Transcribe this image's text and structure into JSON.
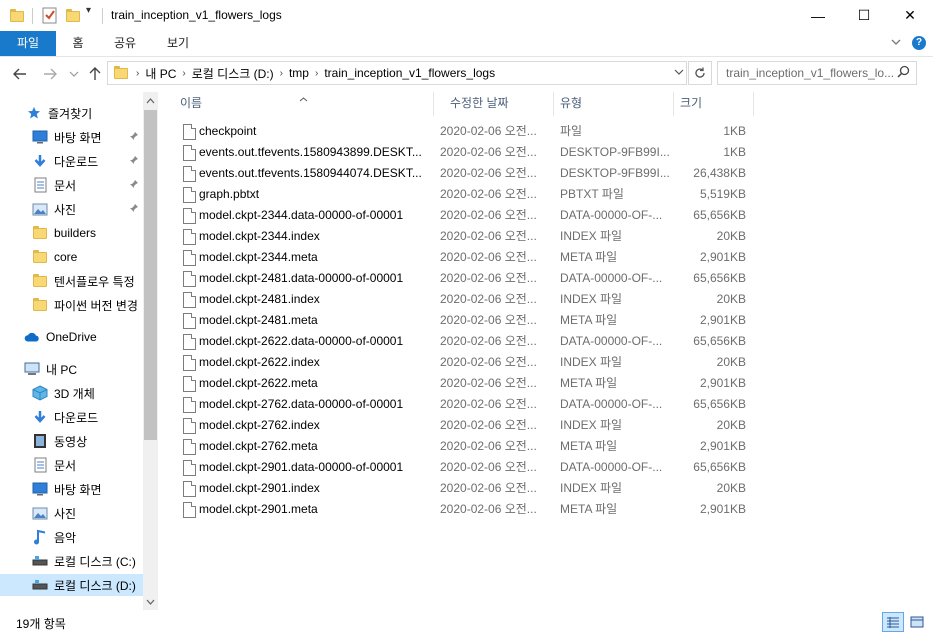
{
  "window": {
    "title": "train_inception_v1_flowers_logs",
    "controls": {
      "minimize": "—",
      "maximize": "☐",
      "close": "✕"
    }
  },
  "ribbon": {
    "tabs": [
      "파일",
      "홈",
      "공유",
      "보기"
    ],
    "expand_icon": "chevron-down-icon",
    "help_icon": "help-icon",
    "help_glyph": "?"
  },
  "address": {
    "breadcrumbs": [
      "내 PC",
      "로컬 디스크 (D:)",
      "tmp",
      "train_inception_v1_flowers_logs"
    ],
    "search_placeholder": "train_inception_v1_flowers_lo..."
  },
  "nav": {
    "items": [
      {
        "label": "즐겨찾기",
        "icon": "star-icon",
        "pinned": false
      },
      {
        "label": "바탕 화면",
        "icon": "desktop-icon",
        "pinned": true
      },
      {
        "label": "다운로드",
        "icon": "download-icon",
        "pinned": true
      },
      {
        "label": "문서",
        "icon": "document-icon",
        "pinned": true
      },
      {
        "label": "사진",
        "icon": "pictures-icon",
        "pinned": true
      },
      {
        "label": "builders",
        "icon": "folder-icon",
        "pinned": false
      },
      {
        "label": "core",
        "icon": "folder-icon",
        "pinned": false
      },
      {
        "label": "텐서플로우 특정",
        "icon": "folder-icon",
        "pinned": false
      },
      {
        "label": "파이썬 버전 변경",
        "icon": "folder-icon",
        "pinned": false
      },
      {
        "label": "OneDrive",
        "icon": "cloud-icon",
        "pinned": false
      },
      {
        "label": "내 PC",
        "icon": "computer-icon",
        "pinned": false
      },
      {
        "label": "3D 개체",
        "icon": "cube-icon",
        "pinned": false
      },
      {
        "label": "다운로드",
        "icon": "download-icon",
        "pinned": false
      },
      {
        "label": "동영상",
        "icon": "video-icon",
        "pinned": false
      },
      {
        "label": "문서",
        "icon": "document-icon",
        "pinned": false
      },
      {
        "label": "바탕 화면",
        "icon": "desktop-icon",
        "pinned": false
      },
      {
        "label": "사진",
        "icon": "pictures-icon",
        "pinned": false
      },
      {
        "label": "음악",
        "icon": "music-icon",
        "pinned": false
      },
      {
        "label": "로컬 디스크 (C:)",
        "icon": "drive-icon",
        "pinned": false
      },
      {
        "label": "로컬 디스크 (D:)",
        "icon": "drive-icon",
        "pinned": false
      }
    ]
  },
  "columns": {
    "name": "이름",
    "date": "수정한 날짜",
    "type": "유형",
    "size": "크기"
  },
  "files": [
    {
      "name": "checkpoint",
      "date": "2020-02-06 오전...",
      "type": "파일",
      "size": "1KB"
    },
    {
      "name": "events.out.tfevents.1580943899.DESKT...",
      "date": "2020-02-06 오전...",
      "type": "DESKTOP-9FB99I...",
      "size": "1KB"
    },
    {
      "name": "events.out.tfevents.1580944074.DESKT...",
      "date": "2020-02-06 오전...",
      "type": "DESKTOP-9FB99I...",
      "size": "26,438KB"
    },
    {
      "name": "graph.pbtxt",
      "date": "2020-02-06 오전...",
      "type": "PBTXT 파일",
      "size": "5,519KB"
    },
    {
      "name": "model.ckpt-2344.data-00000-of-00001",
      "date": "2020-02-06 오전...",
      "type": "DATA-00000-OF-...",
      "size": "65,656KB"
    },
    {
      "name": "model.ckpt-2344.index",
      "date": "2020-02-06 오전...",
      "type": "INDEX 파일",
      "size": "20KB"
    },
    {
      "name": "model.ckpt-2344.meta",
      "date": "2020-02-06 오전...",
      "type": "META 파일",
      "size": "2,901KB"
    },
    {
      "name": "model.ckpt-2481.data-00000-of-00001",
      "date": "2020-02-06 오전...",
      "type": "DATA-00000-OF-...",
      "size": "65,656KB"
    },
    {
      "name": "model.ckpt-2481.index",
      "date": "2020-02-06 오전...",
      "type": "INDEX 파일",
      "size": "20KB"
    },
    {
      "name": "model.ckpt-2481.meta",
      "date": "2020-02-06 오전...",
      "type": "META 파일",
      "size": "2,901KB"
    },
    {
      "name": "model.ckpt-2622.data-00000-of-00001",
      "date": "2020-02-06 오전...",
      "type": "DATA-00000-OF-...",
      "size": "65,656KB"
    },
    {
      "name": "model.ckpt-2622.index",
      "date": "2020-02-06 오전...",
      "type": "INDEX 파일",
      "size": "20KB"
    },
    {
      "name": "model.ckpt-2622.meta",
      "date": "2020-02-06 오전...",
      "type": "META 파일",
      "size": "2,901KB"
    },
    {
      "name": "model.ckpt-2762.data-00000-of-00001",
      "date": "2020-02-06 오전...",
      "type": "DATA-00000-OF-...",
      "size": "65,656KB"
    },
    {
      "name": "model.ckpt-2762.index",
      "date": "2020-02-06 오전...",
      "type": "INDEX 파일",
      "size": "20KB"
    },
    {
      "name": "model.ckpt-2762.meta",
      "date": "2020-02-06 오전...",
      "type": "META 파일",
      "size": "2,901KB"
    },
    {
      "name": "model.ckpt-2901.data-00000-of-00001",
      "date": "2020-02-06 오전...",
      "type": "DATA-00000-OF-...",
      "size": "65,656KB"
    },
    {
      "name": "model.ckpt-2901.index",
      "date": "2020-02-06 오전...",
      "type": "INDEX 파일",
      "size": "20KB"
    },
    {
      "name": "model.ckpt-2901.meta",
      "date": "2020-02-06 오전...",
      "type": "META 파일",
      "size": "2,901KB"
    }
  ],
  "status": {
    "item_count": "19개 항목"
  },
  "colors": {
    "accent": "#1979ca",
    "selection": "#cce8ff"
  }
}
